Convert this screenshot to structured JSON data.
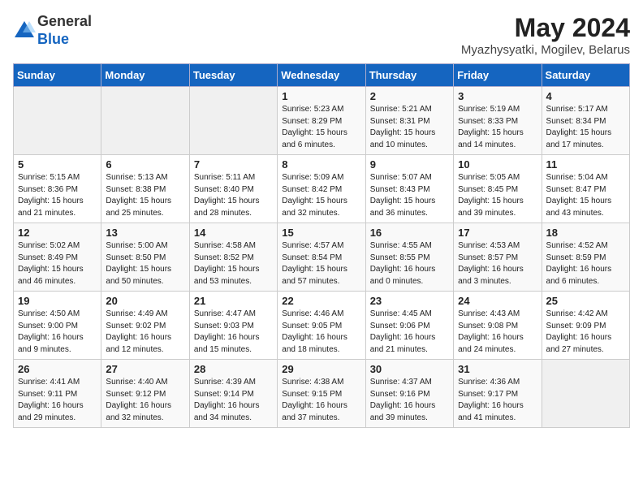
{
  "header": {
    "logo_general": "General",
    "logo_blue": "Blue",
    "title": "May 2024",
    "location": "Myazhysyatki, Mogilev, Belarus"
  },
  "weekdays": [
    "Sunday",
    "Monday",
    "Tuesday",
    "Wednesday",
    "Thursday",
    "Friday",
    "Saturday"
  ],
  "weeks": [
    [
      {
        "day": "",
        "info": ""
      },
      {
        "day": "",
        "info": ""
      },
      {
        "day": "",
        "info": ""
      },
      {
        "day": "1",
        "info": "Sunrise: 5:23 AM\nSunset: 8:29 PM\nDaylight: 15 hours\nand 6 minutes."
      },
      {
        "day": "2",
        "info": "Sunrise: 5:21 AM\nSunset: 8:31 PM\nDaylight: 15 hours\nand 10 minutes."
      },
      {
        "day": "3",
        "info": "Sunrise: 5:19 AM\nSunset: 8:33 PM\nDaylight: 15 hours\nand 14 minutes."
      },
      {
        "day": "4",
        "info": "Sunrise: 5:17 AM\nSunset: 8:34 PM\nDaylight: 15 hours\nand 17 minutes."
      }
    ],
    [
      {
        "day": "5",
        "info": "Sunrise: 5:15 AM\nSunset: 8:36 PM\nDaylight: 15 hours\nand 21 minutes."
      },
      {
        "day": "6",
        "info": "Sunrise: 5:13 AM\nSunset: 8:38 PM\nDaylight: 15 hours\nand 25 minutes."
      },
      {
        "day": "7",
        "info": "Sunrise: 5:11 AM\nSunset: 8:40 PM\nDaylight: 15 hours\nand 28 minutes."
      },
      {
        "day": "8",
        "info": "Sunrise: 5:09 AM\nSunset: 8:42 PM\nDaylight: 15 hours\nand 32 minutes."
      },
      {
        "day": "9",
        "info": "Sunrise: 5:07 AM\nSunset: 8:43 PM\nDaylight: 15 hours\nand 36 minutes."
      },
      {
        "day": "10",
        "info": "Sunrise: 5:05 AM\nSunset: 8:45 PM\nDaylight: 15 hours\nand 39 minutes."
      },
      {
        "day": "11",
        "info": "Sunrise: 5:04 AM\nSunset: 8:47 PM\nDaylight: 15 hours\nand 43 minutes."
      }
    ],
    [
      {
        "day": "12",
        "info": "Sunrise: 5:02 AM\nSunset: 8:49 PM\nDaylight: 15 hours\nand 46 minutes."
      },
      {
        "day": "13",
        "info": "Sunrise: 5:00 AM\nSunset: 8:50 PM\nDaylight: 15 hours\nand 50 minutes."
      },
      {
        "day": "14",
        "info": "Sunrise: 4:58 AM\nSunset: 8:52 PM\nDaylight: 15 hours\nand 53 minutes."
      },
      {
        "day": "15",
        "info": "Sunrise: 4:57 AM\nSunset: 8:54 PM\nDaylight: 15 hours\nand 57 minutes."
      },
      {
        "day": "16",
        "info": "Sunrise: 4:55 AM\nSunset: 8:55 PM\nDaylight: 16 hours\nand 0 minutes."
      },
      {
        "day": "17",
        "info": "Sunrise: 4:53 AM\nSunset: 8:57 PM\nDaylight: 16 hours\nand 3 minutes."
      },
      {
        "day": "18",
        "info": "Sunrise: 4:52 AM\nSunset: 8:59 PM\nDaylight: 16 hours\nand 6 minutes."
      }
    ],
    [
      {
        "day": "19",
        "info": "Sunrise: 4:50 AM\nSunset: 9:00 PM\nDaylight: 16 hours\nand 9 minutes."
      },
      {
        "day": "20",
        "info": "Sunrise: 4:49 AM\nSunset: 9:02 PM\nDaylight: 16 hours\nand 12 minutes."
      },
      {
        "day": "21",
        "info": "Sunrise: 4:47 AM\nSunset: 9:03 PM\nDaylight: 16 hours\nand 15 minutes."
      },
      {
        "day": "22",
        "info": "Sunrise: 4:46 AM\nSunset: 9:05 PM\nDaylight: 16 hours\nand 18 minutes."
      },
      {
        "day": "23",
        "info": "Sunrise: 4:45 AM\nSunset: 9:06 PM\nDaylight: 16 hours\nand 21 minutes."
      },
      {
        "day": "24",
        "info": "Sunrise: 4:43 AM\nSunset: 9:08 PM\nDaylight: 16 hours\nand 24 minutes."
      },
      {
        "day": "25",
        "info": "Sunrise: 4:42 AM\nSunset: 9:09 PM\nDaylight: 16 hours\nand 27 minutes."
      }
    ],
    [
      {
        "day": "26",
        "info": "Sunrise: 4:41 AM\nSunset: 9:11 PM\nDaylight: 16 hours\nand 29 minutes."
      },
      {
        "day": "27",
        "info": "Sunrise: 4:40 AM\nSunset: 9:12 PM\nDaylight: 16 hours\nand 32 minutes."
      },
      {
        "day": "28",
        "info": "Sunrise: 4:39 AM\nSunset: 9:14 PM\nDaylight: 16 hours\nand 34 minutes."
      },
      {
        "day": "29",
        "info": "Sunrise: 4:38 AM\nSunset: 9:15 PM\nDaylight: 16 hours\nand 37 minutes."
      },
      {
        "day": "30",
        "info": "Sunrise: 4:37 AM\nSunset: 9:16 PM\nDaylight: 16 hours\nand 39 minutes."
      },
      {
        "day": "31",
        "info": "Sunrise: 4:36 AM\nSunset: 9:17 PM\nDaylight: 16 hours\nand 41 minutes."
      },
      {
        "day": "",
        "info": ""
      }
    ]
  ]
}
